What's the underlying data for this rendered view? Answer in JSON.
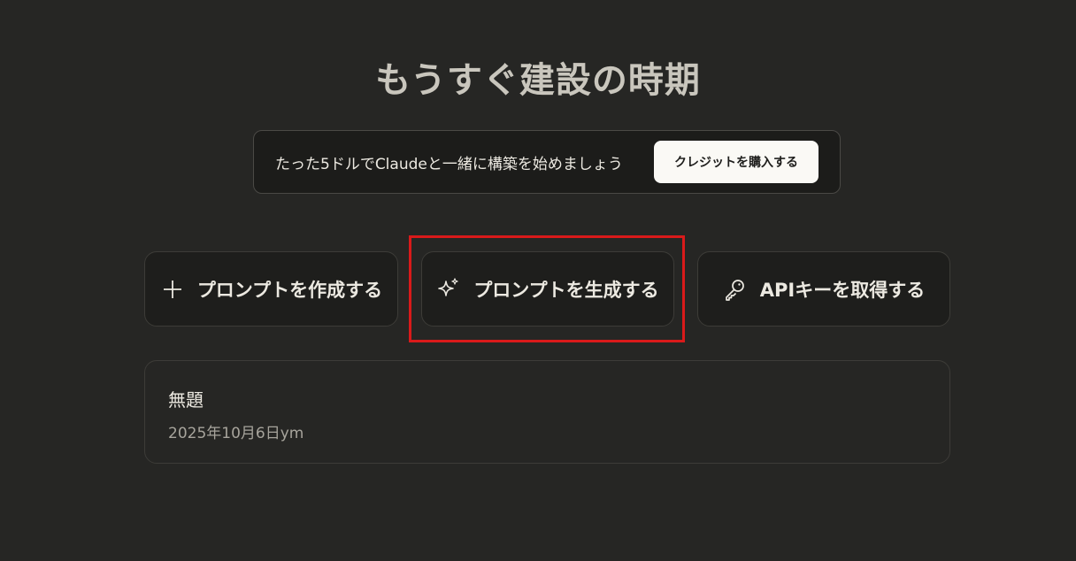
{
  "page_title": "もうすぐ建設の時期",
  "promo": {
    "text": "たった5ドルでClaudeと一緒に構築を始めましょう",
    "button_label": "クレジットを購入する"
  },
  "actions": [
    {
      "label": "プロンプトを作成する",
      "icon": "plus-icon"
    },
    {
      "label": "プロンプトを生成する",
      "icon": "sparkle-icon"
    },
    {
      "label": "APIキーを取得する",
      "icon": "key-icon"
    }
  ],
  "recent": {
    "title": "無題",
    "subtitle": "2025年10月6日ym"
  },
  "colors": {
    "background": "#262624",
    "highlight": "#d91a1a",
    "button_bg": "#faf9f5"
  }
}
